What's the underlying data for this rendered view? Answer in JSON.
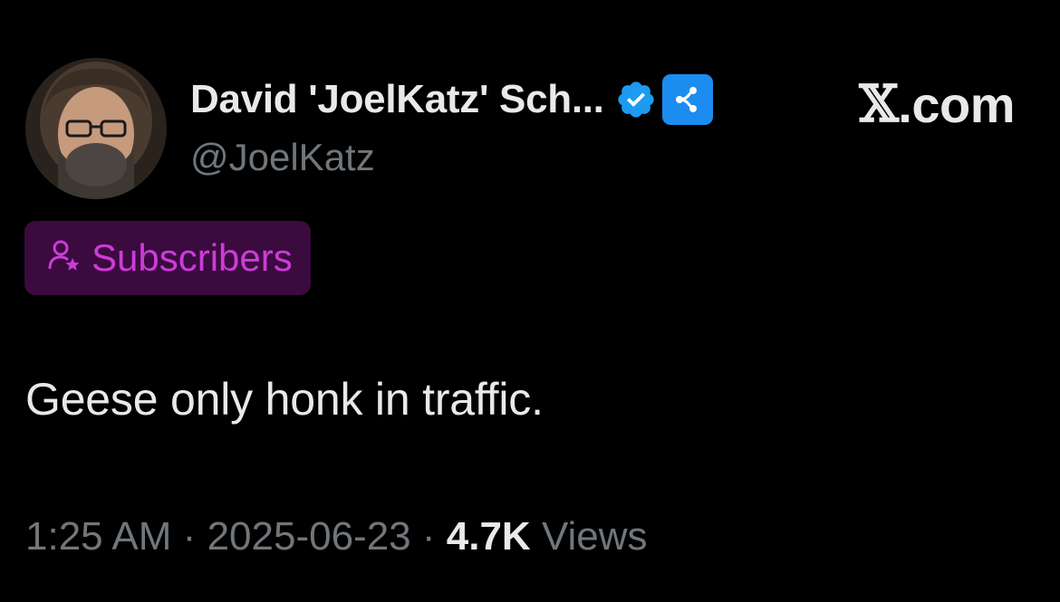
{
  "author": {
    "display_name": "David 'JoelKatz' Sch...",
    "handle": "@JoelKatz",
    "verified": true,
    "avatar_icon": "profile-photo",
    "affiliate_icon": "ripple-logo-icon"
  },
  "brand": {
    "text": ".com",
    "x_glyph": "𝕏"
  },
  "badge": {
    "label": "Subscribers",
    "icon": "person-star-icon",
    "text_color": "#cd3bd8",
    "background": "#3b0a3f"
  },
  "tweet": {
    "text": "Geese only honk in traffic."
  },
  "meta": {
    "time": "1:25 AM",
    "separator": "·",
    "date": "2025-06-23",
    "views_count": "4.7K",
    "views_label": "Views"
  },
  "colors": {
    "background": "#000000",
    "primary_text": "#e7e9ea",
    "secondary_text": "#71767b",
    "verified_blue": "#1d9bf0"
  }
}
